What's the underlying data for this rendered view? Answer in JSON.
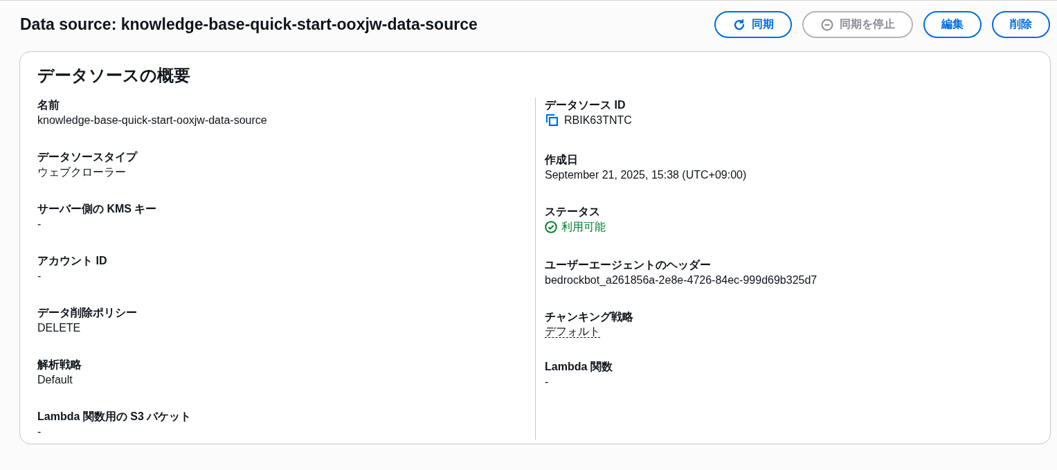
{
  "header": {
    "title": "Data source: knowledge-base-quick-start-ooxjw-data-source"
  },
  "actions": [
    {
      "label": "同期",
      "kind": "refresh",
      "disabled": false
    },
    {
      "label": "同期を停止",
      "kind": "stop",
      "disabled": true
    },
    {
      "label": "編集",
      "disabled": false
    },
    {
      "label": "削除",
      "disabled": false
    }
  ],
  "overview": {
    "title": "データソースの概要",
    "columns": [
      [
        {
          "label": "名前",
          "value": "knowledge-base-quick-start-ooxjw-data-source",
          "kind": "text"
        },
        {
          "label": "データソースタイプ",
          "value": "ウェブクローラー",
          "kind": "text"
        },
        {
          "label": "サーバー側の KMS キー",
          "value": "-",
          "kind": "text"
        },
        {
          "label": "アカウント ID",
          "value": "-",
          "kind": "text"
        },
        {
          "label": "データ削除ポリシー",
          "value": "DELETE",
          "kind": "text"
        },
        {
          "label": "解析戦略",
          "value": "Default",
          "kind": "text"
        },
        {
          "label": "Lambda 関数用の S3 バケット",
          "value": "-",
          "kind": "text"
        }
      ],
      [
        {
          "label": "データソース ID",
          "value": "RBIK63TNTC",
          "kind": "copy"
        },
        {
          "label": "作成日",
          "value": "September 21, 2025, 15:38 (UTC+09:00)",
          "kind": "text"
        },
        {
          "label": "ステータス",
          "value": "利用可能",
          "kind": "status"
        },
        {
          "label": "ユーザーエージェントのヘッダー",
          "value": "bedrockbot_a261856a-2e8e-4726-84ec-999d69b325d7",
          "kind": "text"
        },
        {
          "label": "チャンキング戦略",
          "value": "デフォルト",
          "kind": "popover"
        },
        {
          "label": "Lambda 関数",
          "value": "-",
          "kind": "text"
        }
      ]
    ]
  }
}
